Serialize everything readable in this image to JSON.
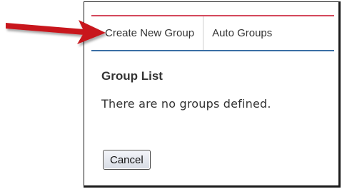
{
  "tabs": [
    {
      "label": "Create New Group"
    },
    {
      "label": "Auto Groups"
    }
  ],
  "group_list": {
    "title": "Group List",
    "empty_message": "There are no groups defined."
  },
  "actions": {
    "cancel_label": "Cancel"
  },
  "colors": {
    "accent_rule": "#d4485c",
    "tab_underline": "#3a6ea5",
    "annotation_arrow": "#c8161d"
  }
}
